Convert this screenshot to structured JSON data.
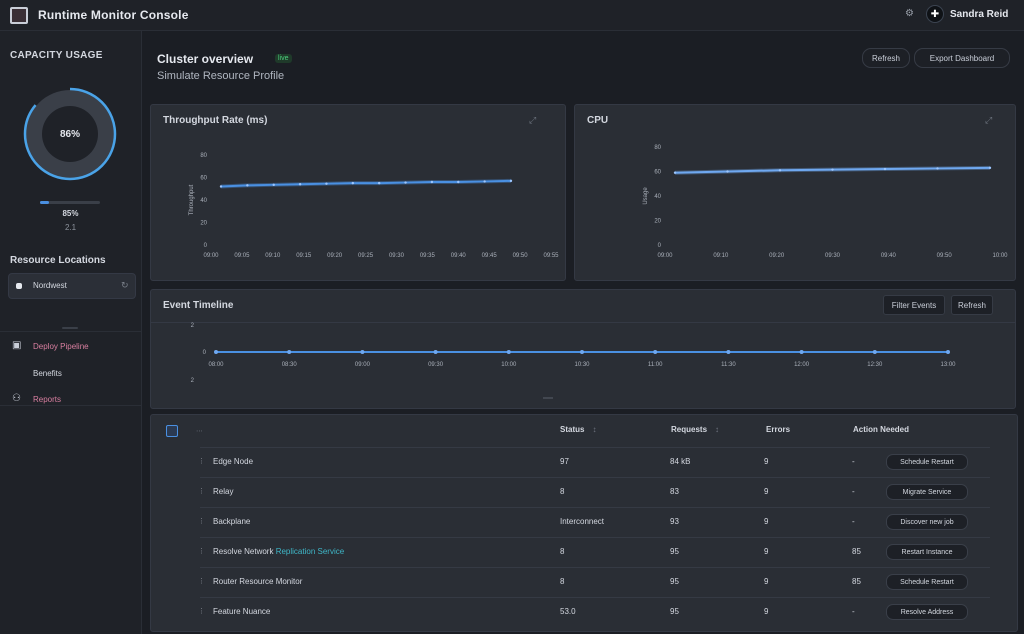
{
  "app": {
    "title": "Runtime Monitor Console",
    "username": "Sandra Reid"
  },
  "sidebar": {
    "title": "CAPACITY USAGE",
    "gauge_value": "86%",
    "gauge_fraction": 0.86,
    "progress_fraction": 0.15,
    "stat_primary": "85%",
    "stat_secondary": "2.1",
    "section2_title": "Resource Locations",
    "field_label": "Nordwest",
    "nav": [
      {
        "icon": "box-icon",
        "label": "Deploy Pipeline",
        "highlight": true
      },
      {
        "icon": "none",
        "label": "Benefits",
        "highlight": false
      },
      {
        "icon": "cluster-icon",
        "label": "Reports",
        "highlight": true
      }
    ]
  },
  "main": {
    "title": "Cluster overview",
    "badge": "live",
    "subtitle": "Simulate Resource Profile",
    "buttons": [
      "Refresh",
      "Export Dashboard"
    ]
  },
  "charts": {
    "left": {
      "title": "Throughput Rate (ms)"
    },
    "right": {
      "title": "CPU"
    },
    "timeline": {
      "title": "Event Timeline",
      "buttons": [
        "Filter Events",
        "Refresh"
      ]
    }
  },
  "table": {
    "headers": [
      "Status",
      "Requests",
      "Errors",
      "Action Needed"
    ],
    "rows": [
      {
        "name": "Edge Node",
        "status": "97",
        "requests": "84 kB",
        "errors": "9",
        "extra": "-",
        "action": "Schedule Restart"
      },
      {
        "name": "Relay",
        "status": "8",
        "requests": "83",
        "errors": "9",
        "extra": "-",
        "action": "Migrate Service"
      },
      {
        "name": "Backplane",
        "status": "Interconnect",
        "requests": "93",
        "errors": "9",
        "extra": "-",
        "action": "Discover new job"
      },
      {
        "name": "Resolve Network",
        "name_tag": "Replication Service",
        "status": "8",
        "requests": "95",
        "errors": "9",
        "extra": "85",
        "action": "Restart Instance"
      },
      {
        "name": "Router Resource Monitor",
        "status": "8",
        "requests": "95",
        "errors": "9",
        "extra": "85",
        "action": "Schedule Restart"
      },
      {
        "name": "Feature Nuance",
        "status": "53.0",
        "requests": "95",
        "errors": "9",
        "extra": "-",
        "action": "Resolve Address"
      }
    ]
  },
  "colors": {
    "accent": "#4a90e2",
    "accent_light": "#6fa8f0",
    "bg": "#1b1e24",
    "panel": "#2a2e35",
    "highlight": "#d97fa0",
    "tag": "#3fb7c8"
  },
  "chart_data": [
    {
      "type": "line",
      "title": "Throughput Rate (ms)",
      "xlabel": "",
      "ylabel": "Throughput",
      "x": [
        "09:00",
        "09:05",
        "09:10",
        "09:15",
        "09:20",
        "09:25",
        "09:30",
        "09:35",
        "09:40",
        "09:45",
        "09:50",
        "09:55"
      ],
      "x_ticks": [
        "09:00",
        "09:05",
        "09:10",
        "09:15",
        "09:20",
        "09:25",
        "09:30",
        "09:35",
        "09:40",
        "09:45",
        "09:50",
        "09:55"
      ],
      "y_ticks": [
        "0",
        "20",
        "40",
        "60",
        "80"
      ],
      "series": [
        {
          "name": "",
          "values": [
            52,
            53,
            53.5,
            54,
            54.5,
            55,
            55,
            55.5,
            56,
            56,
            56.5,
            57
          ]
        }
      ],
      "ylim": [
        0,
        80
      ]
    },
    {
      "type": "line",
      "title": "CPU",
      "xlabel": "",
      "ylabel": "Usage",
      "x": [
        "09:00",
        "09:10",
        "09:20",
        "09:30",
        "09:40",
        "09:50",
        "10:00"
      ],
      "x_ticks": [
        "09:00",
        "09:10",
        "09:20",
        "09:30",
        "09:40",
        "09:50",
        "10:00"
      ],
      "y_ticks": [
        "0",
        "20",
        "40",
        "60",
        "80"
      ],
      "series": [
        {
          "name": "",
          "values": [
            59,
            60,
            61,
            61.5,
            62,
            62.5,
            63
          ]
        }
      ],
      "ylim": [
        0,
        80
      ]
    },
    {
      "type": "scatter",
      "title": "Event Timeline",
      "x_ticks": [
        "08:00",
        "08:30",
        "09:00",
        "09:30",
        "10:00",
        "10:30",
        "11:00",
        "11:30",
        "12:00",
        "12:30",
        "13:00"
      ],
      "y_ticks": [
        "2",
        "0"
      ],
      "x": [
        0,
        1,
        2,
        3,
        4,
        5,
        6,
        7,
        8,
        9,
        10
      ],
      "series": [
        {
          "name": "",
          "values": [
            0,
            0,
            0,
            0,
            0,
            0,
            0,
            0,
            0,
            0,
            0
          ]
        }
      ],
      "ylim": [
        -1,
        1
      ]
    }
  ]
}
